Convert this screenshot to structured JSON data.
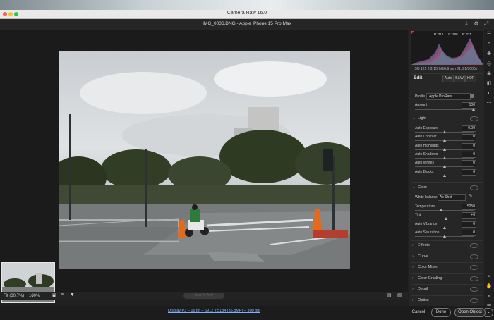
{
  "window": {
    "app_title": "Camera Raw 16.0",
    "doc_title": "IMG_0036.DNG  -  Apple iPhone 15 Pro Max"
  },
  "histogram": {
    "r_label": "R: 212",
    "g_label": "G: 189",
    "b_label": "B: 221"
  },
  "meta": {
    "line": "ISO 125   2.2-15.7@6.9 mm   f/1.8   1/3000s"
  },
  "edit": {
    "title": "Edit",
    "auto": "Auto",
    "bw": "B&W",
    "hdr": "HDR"
  },
  "profile": {
    "label": "Profile",
    "value": "Apple ProRaw",
    "amount_label": "Amount",
    "amount_value": "100"
  },
  "light": {
    "title": "Light",
    "rows": [
      {
        "label": "Auto Exposure",
        "value": "0.00",
        "pos": 0.5
      },
      {
        "label": "Auto Contrast",
        "value": "0",
        "pos": 0.5
      },
      {
        "label": "Auto Highlights",
        "value": "0",
        "pos": 0.5
      },
      {
        "label": "Auto Shadows",
        "value": "0",
        "pos": 0.5
      },
      {
        "label": "Auto Whites",
        "value": "0",
        "pos": 0.5
      },
      {
        "label": "Auto Blacks",
        "value": "0",
        "pos": 0.5
      }
    ]
  },
  "color": {
    "title": "Color",
    "wb_label": "White balance",
    "wb_value": "As Shot",
    "rows": [
      {
        "label": "Temperature",
        "value": "5250",
        "pos": 0.45
      },
      {
        "label": "Tint",
        "value": "+6",
        "pos": 0.53
      },
      {
        "label": "Auto Vibrance",
        "value": "0",
        "pos": 0.5
      },
      {
        "label": "Auto Saturation",
        "value": "0",
        "pos": 0.5
      }
    ]
  },
  "sections": [
    "Effects",
    "Curve",
    "Color Mixer",
    "Color Grading",
    "Detail",
    "Optics",
    "Lens Blur"
  ],
  "lens_blur_badge": "Early Access",
  "bottom": {
    "fit": "Fit (30.7%)",
    "zoom": "100%"
  },
  "status": {
    "link": "Display P3 – 16 bit – 6912 x 5184 (35.8MP) – 300 ppi",
    "cancel": "Cancel",
    "done": "Done",
    "open": "Open Object"
  },
  "colors": {
    "accent": "#2f6fd8",
    "panel": "#262626"
  }
}
